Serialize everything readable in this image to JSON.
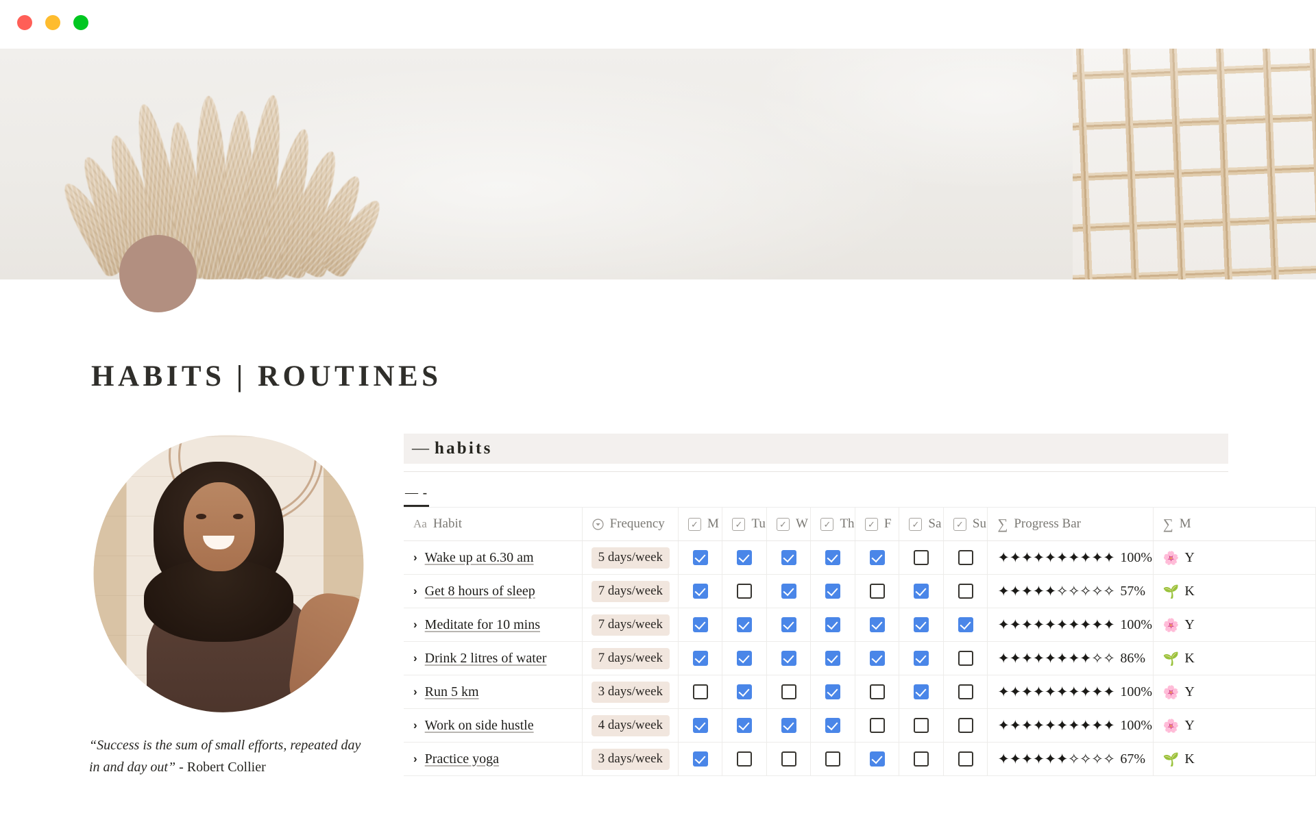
{
  "window": {
    "traffic_lights": [
      {
        "name": "close",
        "color": "#ff5f57"
      },
      {
        "name": "minimize",
        "color": "#febc2e"
      },
      {
        "name": "maximize",
        "color": "#00c720"
      }
    ]
  },
  "page": {
    "icon_color": "#b28f80",
    "title": "HABITS | ROUTINES",
    "quote_text": "“Success is the sum of small efforts, repeated day in and day out”",
    "quote_author": " - Robert Collier"
  },
  "database": {
    "title_dash": "—",
    "title": "habits",
    "tab_dash": "—",
    "tab_label": "-",
    "columns": [
      {
        "key": "habit",
        "label": "Habit",
        "icon": "text-aa-icon"
      },
      {
        "key": "frequency",
        "label": "Frequency",
        "icon": "select-chevron-icon"
      },
      {
        "key": "mon",
        "label": "M",
        "icon": "checkbox-icon"
      },
      {
        "key": "tue",
        "label": "Tu",
        "icon": "checkbox-icon"
      },
      {
        "key": "wed",
        "label": "W",
        "icon": "checkbox-icon"
      },
      {
        "key": "thu",
        "label": "Th",
        "icon": "checkbox-icon"
      },
      {
        "key": "fri",
        "label": "F",
        "icon": "checkbox-icon"
      },
      {
        "key": "sat",
        "label": "Sa",
        "icon": "checkbox-icon"
      },
      {
        "key": "sun",
        "label": "Su",
        "icon": "checkbox-icon"
      },
      {
        "key": "progress",
        "label": "Progress Bar",
        "icon": "formula-sigma-icon"
      },
      {
        "key": "message",
        "label": "M",
        "icon": "formula-sigma-icon"
      }
    ],
    "accent_checkbox_color": "#4a86e8",
    "tag_background": "#f1e6de",
    "rows": [
      {
        "habit": "Wake up at 6.30 am",
        "frequency": "5 days/week",
        "days": [
          true,
          true,
          true,
          true,
          true,
          false,
          false
        ],
        "progress_filled": 10,
        "progress_total": 10,
        "progress_label": "100%",
        "message_emoji": "🌸",
        "message_text": "Y"
      },
      {
        "habit": "Get 8 hours of sleep",
        "frequency": "7 days/week",
        "days": [
          true,
          false,
          true,
          true,
          false,
          true,
          false
        ],
        "progress_filled": 5,
        "progress_total": 10,
        "progress_label": "57%",
        "message_emoji": "🌱",
        "message_text": "K"
      },
      {
        "habit": "Meditate for 10 mins",
        "frequency": "7 days/week",
        "days": [
          true,
          true,
          true,
          true,
          true,
          true,
          true
        ],
        "progress_filled": 10,
        "progress_total": 10,
        "progress_label": "100%",
        "message_emoji": "🌸",
        "message_text": "Y"
      },
      {
        "habit": "Drink 2 litres of water",
        "frequency": "7 days/week",
        "days": [
          true,
          true,
          true,
          true,
          true,
          true,
          false
        ],
        "progress_filled": 8,
        "progress_total": 10,
        "progress_label": "86%",
        "message_emoji": "🌱",
        "message_text": "K"
      },
      {
        "habit": "Run 5 km",
        "frequency": "3 days/week",
        "days": [
          false,
          true,
          false,
          true,
          false,
          true,
          false
        ],
        "progress_filled": 10,
        "progress_total": 10,
        "progress_label": "100%",
        "message_emoji": "🌸",
        "message_text": "Y"
      },
      {
        "habit": "Work on side hustle",
        "frequency": "4 days/week",
        "days": [
          true,
          true,
          true,
          true,
          false,
          false,
          false
        ],
        "progress_filled": 10,
        "progress_total": 10,
        "progress_label": "100%",
        "message_emoji": "🌸",
        "message_text": "Y"
      },
      {
        "habit": "Practice yoga",
        "frequency": "3 days/week",
        "days": [
          true,
          false,
          false,
          false,
          true,
          false,
          false
        ],
        "progress_filled": 6,
        "progress_total": 10,
        "progress_label": "67%",
        "message_emoji": "🌱",
        "message_text": "K"
      }
    ]
  }
}
